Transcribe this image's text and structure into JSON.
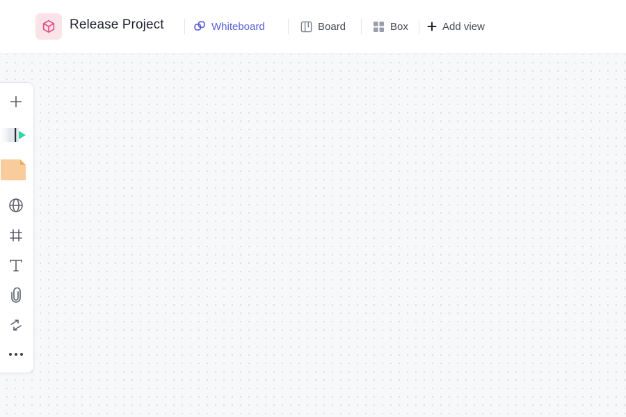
{
  "header": {
    "project_title": "Release Project",
    "project_icon": "cube-icon",
    "tabs": [
      {
        "label": "Whiteboard",
        "icon": "whiteboard-icon",
        "active": true
      },
      {
        "label": "Board",
        "icon": "board-icon",
        "active": false
      },
      {
        "label": "Box",
        "icon": "box-grid-icon",
        "active": false
      }
    ],
    "add_view_label": "Add view"
  },
  "toolbar": {
    "tools": [
      "plus-icon",
      "pen-icon",
      "sticky-note-icon",
      "globe-icon",
      "frame-icon",
      "text-icon",
      "paperclip-icon",
      "connector-icon",
      "more-icon"
    ]
  },
  "colors": {
    "accent": "#5a5fd6",
    "project_icon_bg": "#fbe3ea",
    "project_icon_fg": "#e44f86",
    "sticky_note": "#f9cc9b",
    "pen_teal": "#2fd6a8"
  }
}
